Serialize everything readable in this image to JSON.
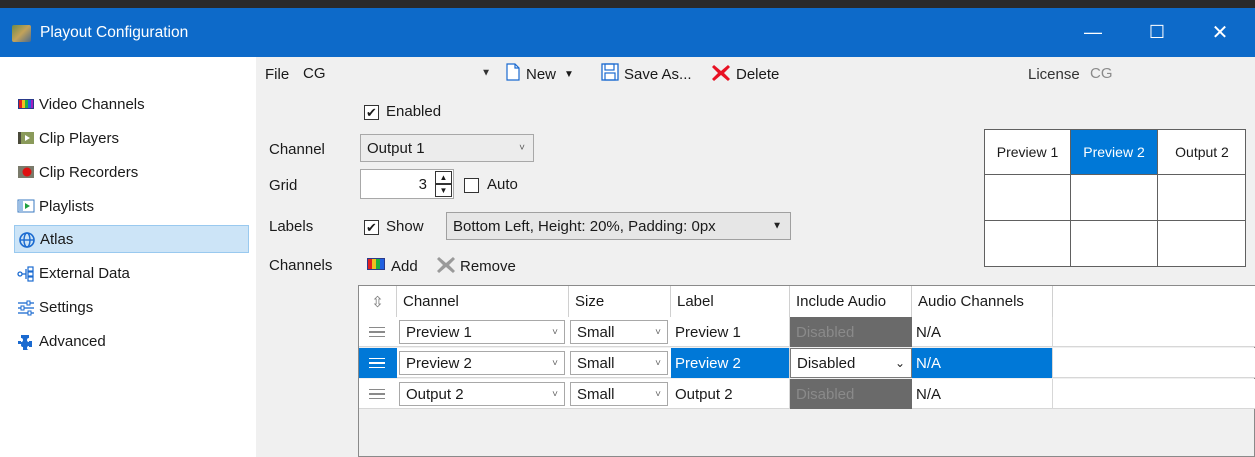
{
  "window": {
    "title": "Playout Configuration",
    "min_glyph": "—",
    "max_glyph": "☐",
    "close_glyph": "✕"
  },
  "sidebar": {
    "items": [
      {
        "label": "Video Channels",
        "icon": "video-channels-icon"
      },
      {
        "label": "Clip Players",
        "icon": "clip-players-icon"
      },
      {
        "label": "Clip Recorders",
        "icon": "clip-recorders-icon"
      },
      {
        "label": "Playlists",
        "icon": "playlists-icon"
      },
      {
        "label": "Atlas",
        "icon": "atlas-globe-icon",
        "selected": true
      },
      {
        "label": "External Data",
        "icon": "external-data-icon"
      },
      {
        "label": "Settings",
        "icon": "settings-sliders-icon"
      },
      {
        "label": "Advanced",
        "icon": "advanced-puzzle-icon"
      }
    ]
  },
  "toolbar": {
    "file_label": "File",
    "file_value": "CG",
    "new_label": "New",
    "save_as_label": "Save As...",
    "delete_label": "Delete",
    "license_label": "License",
    "license_value": "CG"
  },
  "form": {
    "enabled_label": "Enabled",
    "enabled_checked": true,
    "channel_label": "Channel",
    "channel_value": "Output 1",
    "grid_label": "Grid",
    "grid_value": "3",
    "auto_label": "Auto",
    "auto_checked": false,
    "labels_label": "Labels",
    "show_label": "Show",
    "show_checked": true,
    "labels_value": "Bottom Left, Height: 20%, Padding: 0px",
    "channels_label": "Channels",
    "add_label": "Add",
    "remove_label": "Remove"
  },
  "grid_preview": {
    "cells": [
      "Preview 1",
      "Preview 2",
      "Output 2"
    ],
    "selected_index": 1
  },
  "table": {
    "headers": [
      "Channel",
      "Size",
      "Label",
      "Include Audio",
      "Audio Channels"
    ],
    "rows": [
      {
        "channel": "Preview 1",
        "size": "Small",
        "label": "Preview 1",
        "include_audio": "Disabled",
        "include_audio_enabled": false,
        "audio_channels": "N/A",
        "selected": false
      },
      {
        "channel": "Preview 2",
        "size": "Small",
        "label": "Preview 2",
        "include_audio": "Disabled",
        "include_audio_enabled": true,
        "audio_channels": "N/A",
        "selected": true
      },
      {
        "channel": "Output 2",
        "size": "Small",
        "label": "Output 2",
        "include_audio": "Disabled",
        "include_audio_enabled": false,
        "audio_channels": "N/A",
        "selected": false
      }
    ]
  },
  "colors": {
    "titlebar": "#0d6ac9",
    "selection": "#0078d7",
    "sidebar_selected": "#cce4f7",
    "delete_red": "#e81123"
  }
}
